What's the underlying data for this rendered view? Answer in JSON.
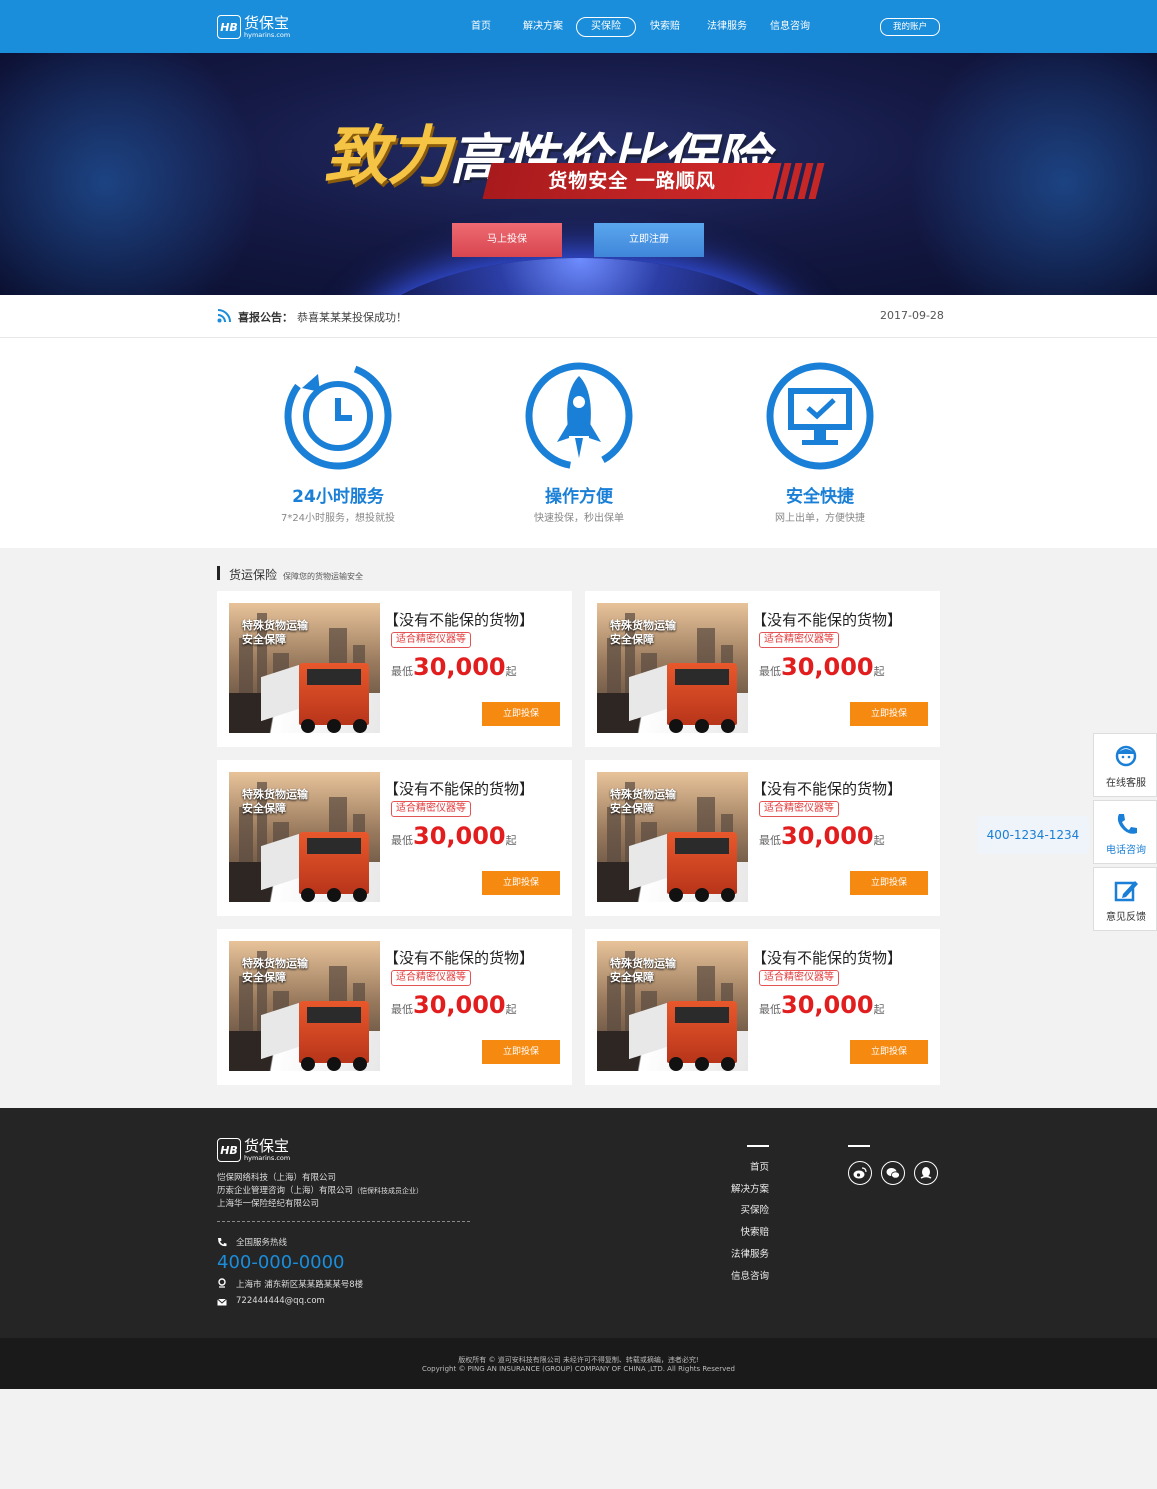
{
  "header": {
    "logo_cn": "货保宝",
    "logo_en": "hymarins.com",
    "logo_mark": "HB",
    "nav": [
      {
        "label": "首页"
      },
      {
        "label": "解决方案"
      },
      {
        "label": "买保险",
        "active": true
      },
      {
        "label": "快索赔"
      },
      {
        "label": "法律服务"
      },
      {
        "label": "信息咨询"
      }
    ],
    "account_label": "我的账户"
  },
  "banner": {
    "headline_gold": "致力",
    "headline_white": "高性价比保险",
    "subtitle": "货物安全  一路顺风",
    "btn_insure": "马上投保",
    "btn_register": "立即注册"
  },
  "notice": {
    "label": "喜报公告：",
    "message": "恭喜某某某投保成功！",
    "date": "2017-09-28"
  },
  "features": [
    {
      "title": "24小时服务",
      "desc": "7*24小时服务，想投就投",
      "icon": "clock-icon"
    },
    {
      "title": "操作方便",
      "desc": "快速投保，秒出保单",
      "icon": "rocket-icon"
    },
    {
      "title": "安全快捷",
      "desc": "网上出单，方便快捷",
      "icon": "monitor-check-icon"
    }
  ],
  "section": {
    "title": "货运保险",
    "subtitle": "保障您的货物运输安全"
  },
  "products": [
    {
      "caption_1": "特殊货物运输",
      "caption_2": "安全保障",
      "title": "【没有不能保的货物】",
      "tag": "适合精密仪器等",
      "price_label": "最低",
      "price": "30,000",
      "price_unit": "起",
      "button": "立即投保"
    },
    {
      "caption_1": "特殊货物运输",
      "caption_2": "安全保障",
      "title": "【没有不能保的货物】",
      "tag": "适合精密仪器等",
      "price_label": "最低",
      "price": "30,000",
      "price_unit": "起",
      "button": "立即投保"
    },
    {
      "caption_1": "特殊货物运输",
      "caption_2": "安全保障",
      "title": "【没有不能保的货物】",
      "tag": "适合精密仪器等",
      "price_label": "最低",
      "price": "30,000",
      "price_unit": "起",
      "button": "立即投保"
    },
    {
      "caption_1": "特殊货物运输",
      "caption_2": "安全保障",
      "title": "【没有不能保的货物】",
      "tag": "适合精密仪器等",
      "price_label": "最低",
      "price": "30,000",
      "price_unit": "起",
      "button": "立即投保"
    },
    {
      "caption_1": "特殊货物运输",
      "caption_2": "安全保障",
      "title": "【没有不能保的货物】",
      "tag": "适合精密仪器等",
      "price_label": "最低",
      "price": "30,000",
      "price_unit": "起",
      "button": "立即投保"
    },
    {
      "caption_1": "特殊货物运输",
      "caption_2": "安全保障",
      "title": "【没有不能保的货物】",
      "tag": "适合精密仪器等",
      "price_label": "最低",
      "price": "30,000",
      "price_unit": "起",
      "button": "立即投保"
    }
  ],
  "float_bar": {
    "service": "在线客服",
    "phone": "电话咨询",
    "feedback": "意见反馈",
    "phone_number": "400-1234-1234"
  },
  "footer": {
    "companies": [
      "恺保网络科技（上海）有限公司",
      "历索企业管理咨询（上海）有限公司",
      "上海华一保险经纪有限公司"
    ],
    "company_2_note": "（恺保科技成员企业）",
    "hotline_label": "全国服务热线",
    "hotline": "400-000-0000",
    "address": "上海市  浦东新区某某路某某号8楼",
    "email": "722444444@qq.com",
    "links": [
      "首页",
      "解决方案",
      "买保险",
      "快索赔",
      "法律服务",
      "信息咨询"
    ],
    "social": [
      "weibo-icon",
      "wechat-icon",
      "qq-icon"
    ]
  },
  "copyright": {
    "line1": "版权所有 © 道可安科技有限公司 未经许可不得复制、转载或摘编，违者必究!",
    "line2": "Copyright © PING AN INSURANCE (GROUP) COMPANY OF CHINA ,LTD. All Rights Reserved"
  },
  "colors": {
    "brand_blue": "#1a8ddb",
    "price_red": "#e11d1d",
    "button_orange": "#f68a10",
    "footer_dark": "#252525"
  }
}
